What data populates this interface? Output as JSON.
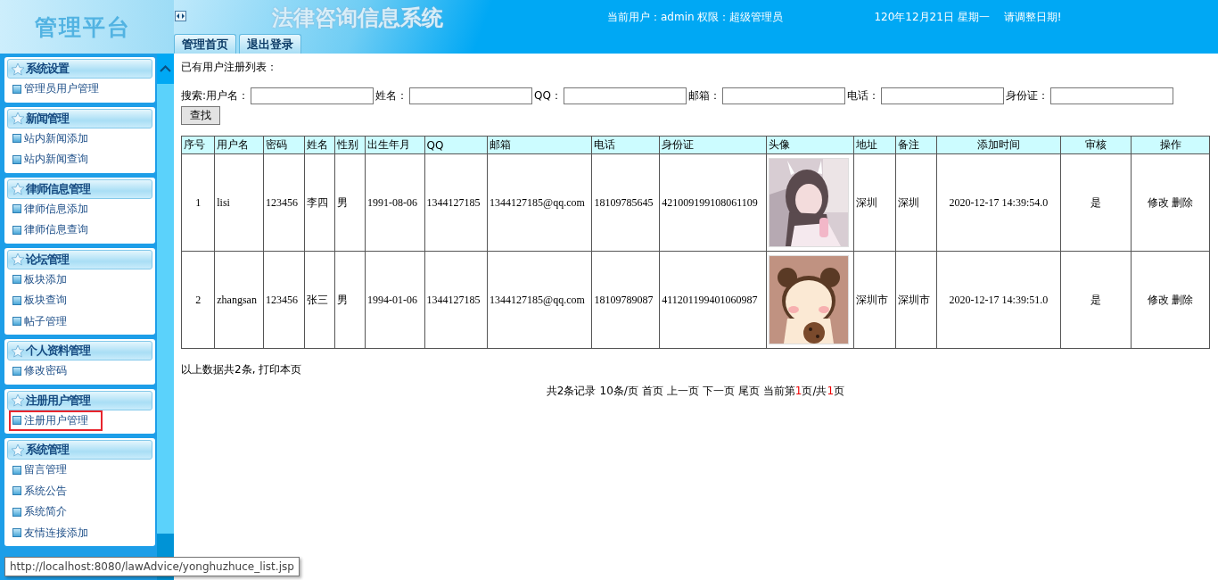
{
  "header": {
    "logo": "管理平台",
    "title": "法律咨询信息系统",
    "user_info": "当前用户：admin 权限：超级管理员",
    "date": "120年12月21日 星期一",
    "date_notice": "请调整日期!",
    "tabs": [
      {
        "label": "管理首页",
        "selected": false
      },
      {
        "label": "退出登录",
        "selected": false
      }
    ]
  },
  "sidebar": {
    "groups": [
      {
        "title": "系统设置",
        "items": [
          {
            "label": "管理员用户管理",
            "selected": false
          }
        ]
      },
      {
        "title": "新闻管理",
        "items": [
          {
            "label": "站内新闻添加",
            "selected": false
          },
          {
            "label": "站内新闻查询",
            "selected": false
          }
        ]
      },
      {
        "title": "律师信息管理",
        "items": [
          {
            "label": "律师信息添加",
            "selected": false
          },
          {
            "label": "律师信息查询",
            "selected": false
          }
        ]
      },
      {
        "title": "论坛管理",
        "items": [
          {
            "label": "板块添加",
            "selected": false
          },
          {
            "label": "板块查询",
            "selected": false
          },
          {
            "label": "帖子管理",
            "selected": false
          }
        ]
      },
      {
        "title": "个人资料管理",
        "items": [
          {
            "label": "修改密码",
            "selected": false
          }
        ]
      },
      {
        "title": "注册用户管理",
        "items": [
          {
            "label": "注册用户管理",
            "selected": true
          }
        ]
      },
      {
        "title": "系统管理",
        "items": [
          {
            "label": "留言管理",
            "selected": false
          },
          {
            "label": "系统公告",
            "selected": false
          },
          {
            "label": "系统简介",
            "selected": false
          },
          {
            "label": "友情连接添加",
            "selected": false
          }
        ]
      }
    ]
  },
  "content": {
    "heading": "已有用户注册列表：",
    "search": {
      "prefix": "搜索:",
      "fields": [
        {
          "label": "用户名："
        },
        {
          "label": "姓名："
        },
        {
          "label": "QQ："
        },
        {
          "label": "邮箱："
        },
        {
          "label": "电话："
        },
        {
          "label": "身份证："
        }
      ],
      "button": "查找"
    },
    "table": {
      "columns": [
        "序号",
        "用户名",
        "密码",
        "姓名",
        "性别",
        "出生年月",
        "QQ",
        "邮箱",
        "电话",
        "身份证",
        "头像",
        "地址",
        "备注",
        "添加时间",
        "审核",
        "操作"
      ],
      "rows": [
        {
          "cells": [
            "1",
            "lisi",
            "123456",
            "李四",
            "男",
            "1991-08-06",
            "1344127185",
            "1344127185@qq.com",
            "18109785645",
            "421009199108061109",
            "",
            "深圳",
            "深圳",
            "2020-12-17 14:39:54.0",
            "是"
          ],
          "actions": [
            "修改",
            "删除"
          ]
        },
        {
          "cells": [
            "2",
            "zhangsan",
            "123456",
            "张三",
            "男",
            "1994-01-06",
            "1344127185",
            "1344127185@qq.com",
            "18109789087",
            "411201199401060987",
            "",
            "深圳市",
            "深圳市",
            "2020-12-17 14:39:51.0",
            "是"
          ],
          "actions": [
            "修改",
            "删除"
          ]
        }
      ]
    },
    "summary": "以上数据共2条, 打印本页",
    "pager": {
      "total": "共2条记录",
      "per_page": "10条/页",
      "links": [
        "首页",
        "上一页",
        "下一页",
        "尾页"
      ],
      "current_prefix": "当前第",
      "current": "1",
      "middle": "页/共",
      "pages": "1",
      "suffix": "页"
    }
  },
  "tooltip": "http://localhost:8080/lawAdvice/yonghuzhuce_list.jsp"
}
